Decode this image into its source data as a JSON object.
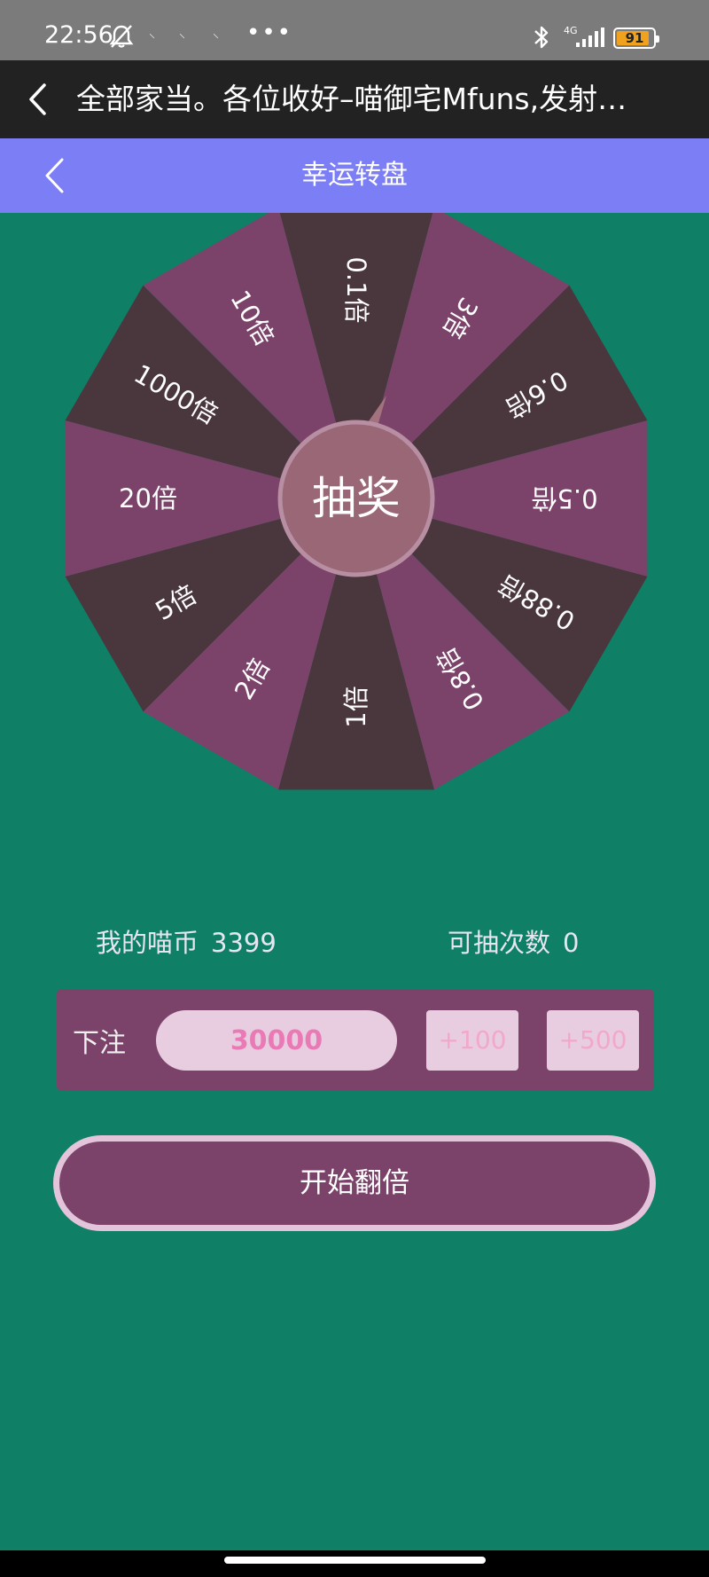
{
  "status_bar": {
    "time": "22:56",
    "notif_a": "⸌",
    "notif_b": "⸌",
    "notif_c": "⸌",
    "more": "•••",
    "network": "4G",
    "battery": "91",
    "battery_fraction": 0.91
  },
  "app_bar": {
    "title": "全部家当。各位收好–喵御宅Mfuns,发射…"
  },
  "page_header": {
    "title": "幸运转盘"
  },
  "wheel": {
    "segments": [
      "0.1倍",
      "3倍",
      "0.6倍",
      "0.5倍",
      "0.88倍",
      "0.8倍",
      "1倍",
      "2倍",
      "5倍",
      "20倍",
      "1000倍",
      "10倍"
    ],
    "center_label": "抽奖",
    "colors": {
      "dark": "#4a363d",
      "pink": "#7c436a",
      "center": "#9a6777",
      "center_ring": "#b88ea2",
      "pointer": "#a2727f"
    }
  },
  "stats": {
    "coins_label": "我的喵币",
    "coins_value": "3399",
    "draws_label": "可抽次数",
    "draws_value": "0"
  },
  "bet": {
    "label": "下注",
    "amount": "30000",
    "add_100": "+100",
    "add_500": "+500"
  },
  "start_button": {
    "label": "开始翻倍"
  },
  "colors": {
    "background": "#0f7f66",
    "header": "#7c7ef6",
    "accent_pink": "#ea7ab6"
  }
}
